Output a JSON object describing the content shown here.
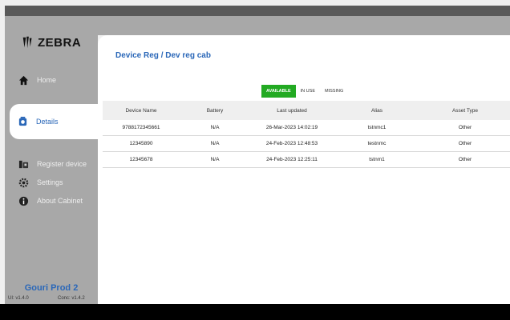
{
  "brand": {
    "logo_text": "ZEBRA"
  },
  "sidebar": {
    "items": [
      {
        "label": "Home",
        "icon": "home-icon"
      },
      {
        "label": "Details",
        "icon": "device-icon"
      },
      {
        "label": "Register device",
        "icon": "register-device-icon"
      },
      {
        "label": "Settings",
        "icon": "settings-icon"
      },
      {
        "label": "About Cabinet",
        "icon": "info-icon"
      }
    ],
    "footer_title": "Gouri Prod 2",
    "ui_version": "UI: v1.4.0",
    "conc_version": "Conc: v1.4.2"
  },
  "main": {
    "title": "Device Reg / Dev reg cab",
    "tabs": [
      {
        "label": "AVAILABLE",
        "active": true
      },
      {
        "label": "IN USE",
        "active": false
      },
      {
        "label": "MISSING",
        "active": false
      }
    ],
    "table": {
      "headers": [
        "Device Name",
        "Battery",
        "Last updated",
        "Alias",
        "Asset Type"
      ],
      "rows": [
        [
          "9788172345661",
          "N/A",
          "26-Mar-2023 14:02:19",
          "tstnmc1",
          "Other"
        ],
        [
          "12345890",
          "N/A",
          "24-Feb-2023 12:48:53",
          "testnmc",
          "Other"
        ],
        [
          "12345678",
          "N/A",
          "24-Feb-2023 12:25:11",
          "tstnm1",
          "Other"
        ]
      ]
    }
  },
  "colors": {
    "accent": "#2a67b8",
    "active_tab": "#22aa22",
    "sidebar_bg": "#a8a8a8"
  }
}
